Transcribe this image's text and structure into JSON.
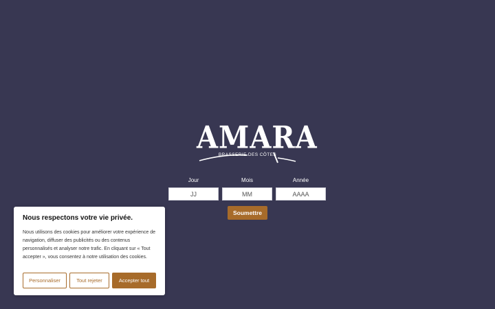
{
  "brand": {
    "wordmark": "AMARA",
    "tagline": "BRASSERIE DES CÔTES",
    "logo_color": "#ffffff"
  },
  "age_gate": {
    "day": {
      "label": "Jour",
      "placeholder": "JJ",
      "value": ""
    },
    "month": {
      "label": "Mois",
      "placeholder": "MM",
      "value": ""
    },
    "year": {
      "label": "Année",
      "placeholder": "AAAA",
      "value": ""
    },
    "submit_label": "Soumettre"
  },
  "cookie_banner": {
    "title": "Nous respectons votre vie privée.",
    "text": "Nous utilisons des cookies pour améliorer votre expérience de navigation, diffuser des publicités ou des contenus personnalisés et analyser notre trafic. En cliquant sur « Tout accepter », vous consentez à notre utilisation des cookies.",
    "customize_label": "Personnaliser",
    "reject_label": "Tout rejeter",
    "accept_label": "Accepter tout"
  },
  "colors": {
    "background": "#383752",
    "accent": "#a76b2a",
    "panel": "#ffffff"
  }
}
